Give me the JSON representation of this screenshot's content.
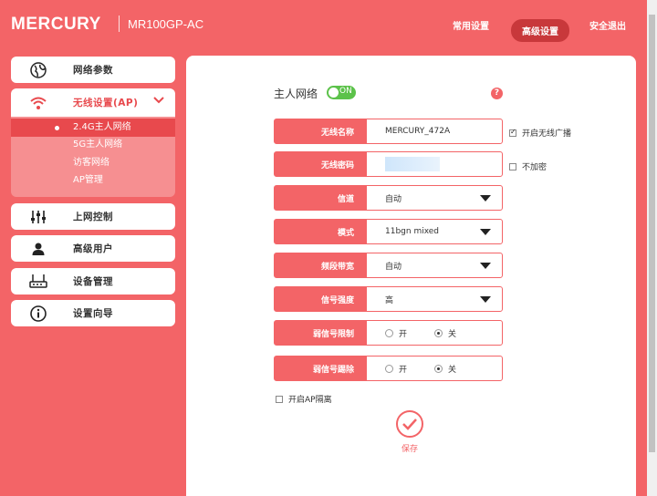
{
  "header": {
    "brand": "MERCURY",
    "model": "MR100GP-AC",
    "nav": [
      "常用设置",
      "高级设置",
      "安全退出"
    ]
  },
  "sidebar": {
    "items": [
      {
        "label": "网络参数",
        "icon": "globe-icon"
      },
      {
        "label": "无线设置(AP)",
        "icon": "wifi-icon"
      },
      {
        "label": "上网控制",
        "icon": "sliders-icon"
      },
      {
        "label": "高级用户",
        "icon": "user-icon"
      },
      {
        "label": "设备管理",
        "icon": "router-icon"
      },
      {
        "label": "设置向导",
        "icon": "info-icon"
      }
    ],
    "submenu": [
      "2.4G主人网络",
      "5G主人网络",
      "访客网络",
      "AP管理"
    ]
  },
  "main": {
    "title": "主人网络",
    "toggle": "ON",
    "help": "?",
    "ssid_label": "无线名称",
    "ssid_value": "MERCURY_472A",
    "broadcast_label": "开启无线广播",
    "pwd_label": "无线密码",
    "nopwd_label": "不加密",
    "channel_label": "信道",
    "channel_value": "自动",
    "mode_label": "模式",
    "mode_value": "11bgn mixed",
    "bw_label": "频段带宽",
    "bw_value": "自动",
    "power_label": "信号强度",
    "power_value": "高",
    "weak_limit_label": "弱信号限制",
    "weak_kick_label": "弱信号踢除",
    "on": "开",
    "off": "关",
    "ap_isolation_label": "开启AP隔离",
    "save_label": "保存"
  },
  "colors": {
    "accent": "#f36467",
    "toggle": "#5cc24a"
  }
}
